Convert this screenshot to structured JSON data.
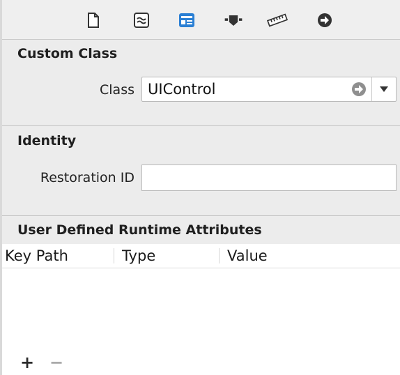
{
  "toolbar": {
    "icons": [
      {
        "name": "file-inspector-icon",
        "selected": false
      },
      {
        "name": "quick-help-icon",
        "selected": false
      },
      {
        "name": "identity-inspector-icon",
        "selected": true
      },
      {
        "name": "attributes-inspector-icon",
        "selected": false
      },
      {
        "name": "size-inspector-icon",
        "selected": false
      },
      {
        "name": "connections-inspector-icon",
        "selected": false
      }
    ],
    "selected_color": "#2a7fd4"
  },
  "custom_class": {
    "title": "Custom Class",
    "class_label": "Class",
    "class_value": "UIControl"
  },
  "identity": {
    "title": "Identity",
    "restoration_label": "Restoration ID",
    "restoration_value": ""
  },
  "runtime_attributes": {
    "title": "User Defined Runtime Attributes",
    "columns": [
      "Key Path",
      "Type",
      "Value"
    ],
    "rows": []
  },
  "bottom": {
    "add_label": "+",
    "remove_label": "−"
  }
}
